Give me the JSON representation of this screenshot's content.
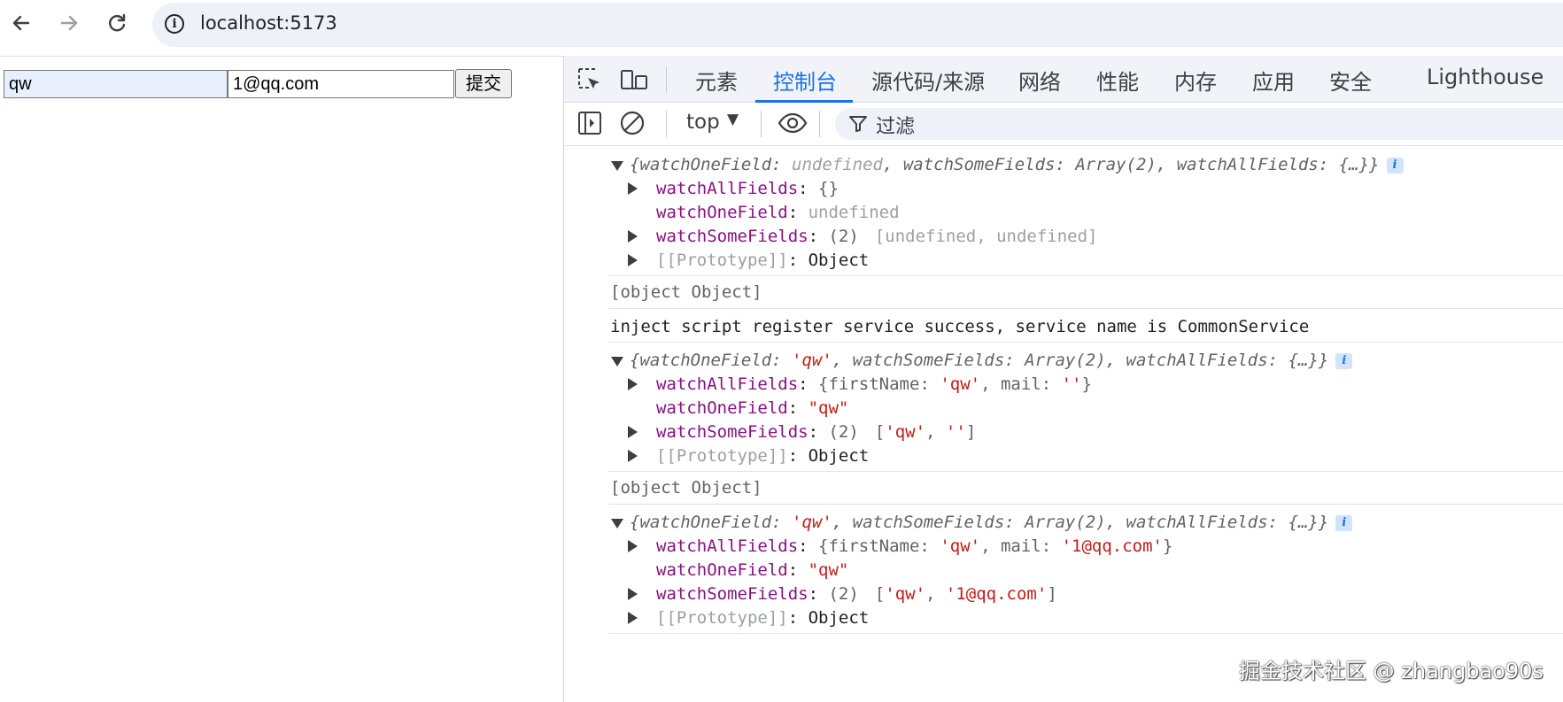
{
  "browser": {
    "url": "localhost:5173"
  },
  "page": {
    "input_first": "qw",
    "input_mail": "1@qq.com",
    "submit_label": "提交"
  },
  "devtools": {
    "tabs": [
      "元素",
      "控制台",
      "源代码/来源",
      "网络",
      "性能",
      "内存",
      "应用",
      "安全",
      "Lighthouse"
    ],
    "active_tab": "控制台",
    "context": "top",
    "filter_placeholder": "过滤"
  },
  "console": {
    "group1": {
      "summary_a": "{watchOneField: ",
      "summary_b": "undefined",
      "summary_c": ", watchSomeFields: Array(2), watchAllFields: {…}}",
      "info": "i",
      "row1_key": "watchAllFields",
      "row1_val": "{}",
      "row2_key": "watchOneField",
      "row2_val": "undefined",
      "row3_key": "watchSomeFields",
      "row3_count": "(2)",
      "row3_val": "[undefined, undefined]",
      "row4_key": "[[Prototype]]",
      "row4_val": "Object"
    },
    "msg1": "[object Object]",
    "msg2": "inject script register service success, service name is CommonService",
    "group2": {
      "summary_a": "{watchOneField: ",
      "summary_b": "'qw'",
      "summary_c": ", watchSomeFields: Array(2), watchAllFields: {…}}",
      "info": "i",
      "row1_key": "watchAllFields",
      "row1_a": "{firstName: ",
      "row1_b": "'qw'",
      "row1_c": ", mail: ",
      "row1_d": "''",
      "row1_e": "}",
      "row2_key": "watchOneField",
      "row2_val": "\"qw\"",
      "row3_key": "watchSomeFields",
      "row3_count": "(2)",
      "row3_a": "[",
      "row3_b": "'qw'",
      "row3_c": ", ",
      "row3_d": "''",
      "row3_e": "]",
      "row4_key": "[[Prototype]]",
      "row4_val": "Object"
    },
    "msg3": "[object Object]",
    "group3": {
      "summary_a": "{watchOneField: ",
      "summary_b": "'qw'",
      "summary_c": ", watchSomeFields: Array(2), watchAllFields: {…}}",
      "info": "i",
      "row1_key": "watchAllFields",
      "row1_a": "{firstName: ",
      "row1_b": "'qw'",
      "row1_c": ", mail: ",
      "row1_d": "'1@qq.com'",
      "row1_e": "}",
      "row2_key": "watchOneField",
      "row2_val": "\"qw\"",
      "row3_key": "watchSomeFields",
      "row3_count": "(2)",
      "row3_a": "[",
      "row3_b": "'qw'",
      "row3_c": ", ",
      "row3_d": "'1@qq.com'",
      "row3_e": "]",
      "row4_key": "[[Prototype]]",
      "row4_val": "Object"
    }
  },
  "watermark": "掘金技术社区 @ zhangbao90s",
  "icons": {
    "back": "arrow-left-icon",
    "forward": "arrow-right-icon",
    "reload": "reload-icon",
    "site_info": "info-icon",
    "inspect": "inspect-element-icon",
    "device": "device-toolbar-icon",
    "sidebar": "sidebar-toggle-icon",
    "clear": "clear-console-icon",
    "eye": "live-expression-icon",
    "filter": "filter-icon"
  }
}
